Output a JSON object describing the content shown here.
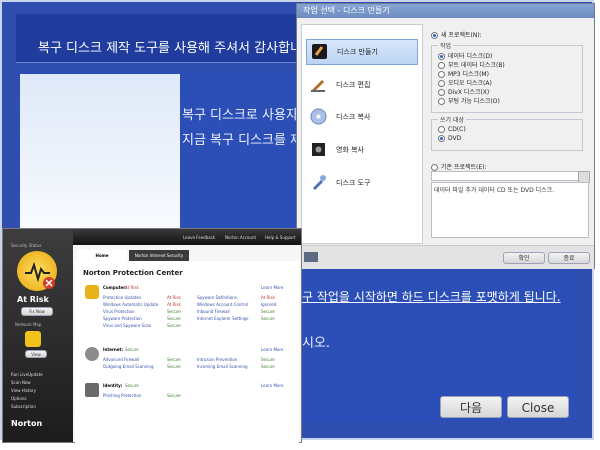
{
  "recovery": {
    "banner_text": "복구 디스크 제작 도구를 사용해 주셔서 감사합니다",
    "line1": "복구 디스크로 사용자",
    "line2": "지금 복구 디스크를 제",
    "link_text": "구 작업을 시작하면 하드 디스크를 포맷하게 됩니다.",
    "line3": "시오.",
    "next_label": "다음",
    "close_label": "Close"
  },
  "disc": {
    "title": "작업 선택 - 디스크 만들기",
    "menu": [
      {
        "label": "디스크 만들기",
        "icon": "disc-create-icon"
      },
      {
        "label": "디스크 편집",
        "icon": "disc-edit-icon"
      },
      {
        "label": "디스크 복사",
        "icon": "disc-copy-icon"
      },
      {
        "label": "영화 복사",
        "icon": "movie-copy-icon"
      },
      {
        "label": "디스크 도구",
        "icon": "disc-tools-icon"
      }
    ],
    "new_project": "새 프로젝트(N):",
    "task_label": "작업",
    "tasks": [
      "데이터 디스크(D)",
      "부트 데이터 디스크(B)",
      "MP3 디스크(M)",
      "오디오 디스크(A)",
      "DivX 디스크(X)",
      "부팅 가능 디스크(O)"
    ],
    "write_label": "쓰기 대상",
    "targets": [
      "CD(C)",
      "DVD"
    ],
    "existing_project": "기존 프로젝트(E):",
    "description": "데이터 파일 추가 데이터 CD 또는 DVD 디스크.",
    "ok_label": "확인",
    "close_label": "종료"
  },
  "norton": {
    "top_links": [
      "Leave Feedback",
      "Norton Account",
      "Help & Support"
    ],
    "security_status": "Security Status",
    "status": "At Risk",
    "fix_now": "Fix Now",
    "network_map": "Network Map",
    "view": "View",
    "side_links": [
      "Run LiveUpdate",
      "Scan Now",
      "View History",
      "Options",
      "Subscription"
    ],
    "brand": "Norton",
    "tabs": [
      "Home",
      "Norton Internet Security"
    ],
    "heading": "Norton Protection Center",
    "computer": {
      "title": "Computer:",
      "state": "At Risk",
      "items": [
        [
          "Protection Updates",
          "At Risk",
          "Spyware Definitions",
          "At Risk"
        ],
        [
          "Windows Automatic Update",
          "At Risk",
          "Windows Account Control",
          "Ignored"
        ],
        [
          "Virus Protection",
          "Secure",
          "Inbound Firewall",
          "Secure"
        ],
        [
          "Spyware Protection",
          "Secure",
          "Internet Explorer Settings",
          "Secure"
        ],
        [
          "Virus and Spyware Scan",
          "Secure",
          "",
          ""
        ]
      ]
    },
    "internet": {
      "title": "Internet:",
      "state": "Secure",
      "items": [
        [
          "Advanced Firewall",
          "Secure",
          "Intrusion Prevention",
          "Secure"
        ],
        [
          "Outgoing Email Scanning",
          "Secure",
          "Incoming Email Scanning",
          "Secure"
        ]
      ]
    },
    "identity": {
      "title": "Identity:",
      "state": "Secure",
      "items": [
        [
          "Phishing Protection",
          "Secure",
          "",
          ""
        ]
      ]
    },
    "learn_more": "Learn More"
  }
}
